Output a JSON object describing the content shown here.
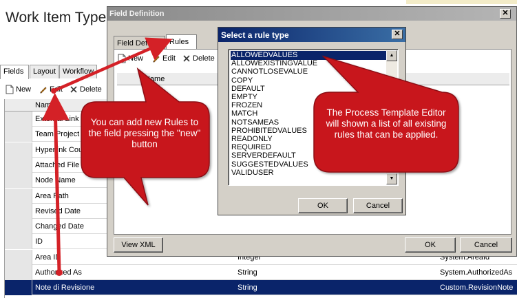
{
  "app": {
    "title": "Work Item Type",
    "tabs": [
      "Fields",
      "Layout",
      "Workflow"
    ],
    "toolbar": {
      "new": "New",
      "edit": "Edit",
      "delete": "Delete"
    },
    "grid": {
      "header_name": "Name",
      "rows": [
        {
          "name": "External Link C",
          "type": "",
          "ref": ""
        },
        {
          "name": "Team Project",
          "type": "",
          "ref": ""
        },
        {
          "name": "Hyperlink Cour",
          "type": "",
          "ref": ""
        },
        {
          "name": "Attached File C",
          "type": "",
          "ref": ""
        },
        {
          "name": "Node Name",
          "type": "",
          "ref": ""
        },
        {
          "name": "Area Path",
          "type": "",
          "ref": ""
        },
        {
          "name": "Revised Date",
          "type": "",
          "ref": ""
        },
        {
          "name": "Changed Date",
          "type": "",
          "ref": ""
        },
        {
          "name": "ID",
          "type": "",
          "ref": ""
        },
        {
          "name": "Area ID",
          "type": "Integer",
          "ref": "System.AreaId"
        },
        {
          "name": "Authorized As",
          "type": "String",
          "ref": "System.AuthorizedAs"
        },
        {
          "name": "Note di Revisione",
          "type": "String",
          "ref": "Custom.RevisionNote"
        }
      ]
    }
  },
  "field_definition": {
    "title": "Field Definition",
    "close": "✕",
    "tabs": [
      "Field Definition",
      "Rules"
    ],
    "toolbar": {
      "new": "New",
      "edit": "Edit",
      "delete": "Delete"
    },
    "header_rule": "Name",
    "view_xml": "View XML",
    "ok": "OK",
    "cancel": "Cancel"
  },
  "rule_type": {
    "title": "Select a rule type",
    "close": "✕",
    "items": [
      "ALLOWEDVALUES",
      "ALLOWEXISTINGVALUE",
      "CANNOTLOSEVALUE",
      "COPY",
      "DEFAULT",
      "EMPTY",
      "FROZEN",
      "MATCH",
      "NOTSAMEAS",
      "PROHIBITEDVALUES",
      "READONLY",
      "REQUIRED",
      "SERVERDEFAULT",
      "SUGGESTEDVALUES",
      "VALIDUSER"
    ],
    "selected": "ALLOWEDVALUES",
    "ok": "OK",
    "cancel": "Cancel"
  },
  "callouts": {
    "left": "You can add new Rules to the field pressing the \"new\" button",
    "right": "The Process Template Editor will shown a list of all existing rules that can be applied."
  },
  "colors": {
    "callout_red": "#c8191e",
    "arrow_red": "#d42127",
    "selection_blue": "#0a246a"
  }
}
